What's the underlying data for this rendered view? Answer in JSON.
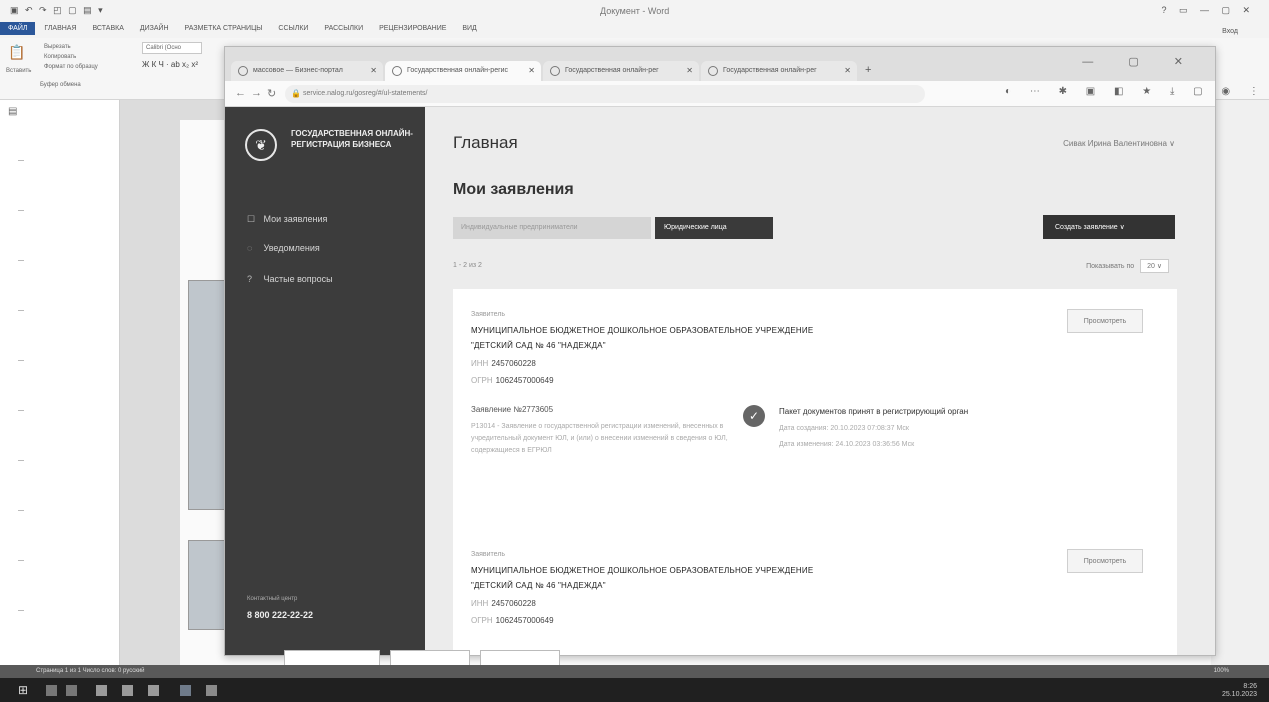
{
  "word": {
    "title": "Документ - Word",
    "tabs": [
      "ФАЙЛ",
      "ГЛАВНАЯ",
      "ВСТАВКА",
      "ДИЗАЙН",
      "РАЗМЕТКА СТРАНИЦЫ",
      "ССЫЛКИ",
      "РАССЫЛКИ",
      "РЕЦЕНЗИРОВАНИЕ",
      "ВИД"
    ],
    "user": "Вход",
    "font_box": "Calibri (Осно",
    "clipboard_label": "Буфер обмена",
    "paste_label": "Вставить",
    "cut_label": "Вырезать",
    "copy_label": "Копировать",
    "format_label": "Формат по образцу"
  },
  "browser": {
    "tabs": [
      {
        "title": "массовое — Бизнес-портал"
      },
      {
        "title": "Государственная онлайн-регис"
      },
      {
        "title": "Государственная онлайн-рег"
      },
      {
        "title": "Государственная онлайн-рег"
      }
    ],
    "url": "service.nalog.ru/gosreg/#/ul-statements/"
  },
  "sidebar": {
    "brand": "ГОСУДАРСТВЕННАЯ ОНЛАЙН-РЕГИСТРАЦИЯ БИЗНЕСА",
    "menu": [
      {
        "icon": "☐",
        "label": "Мои заявления"
      },
      {
        "icon": "◌",
        "label": "Уведомления"
      },
      {
        "icon": "?",
        "label": "Частые вопросы"
      }
    ],
    "hotline_label": "Контактный центр",
    "hotline": "8 800 222-22-22"
  },
  "header": {
    "title": "Главная",
    "user": "Сивак Ирина Валентиновна"
  },
  "statements": {
    "title": "Мои заявления",
    "tab_ip": "Индивидуальные предприниматели",
    "tab_ul": "Юридические лица",
    "create_button": "Создать заявление ∨",
    "pager": "1 - 2 из 2",
    "per_page_label": "Показывать по",
    "per_page_value": "20"
  },
  "cards": [
    {
      "label": "Заявитель",
      "name_line1": "МУНИЦИПАЛЬНОЕ БЮДЖЕТНОЕ ДОШКОЛЬНОЕ ОБРАЗОВАТЕЛЬНОЕ УЧРЕЖДЕНИЕ",
      "name_line2": "\"ДЕТСКИЙ САД № 46 \"НАДЕЖДА\"",
      "inn_key": "ИНН",
      "inn": "2457060228",
      "ogrn_key": "ОГРН",
      "ogrn": "1062457000649",
      "button": "Просмотреть",
      "app": "Заявление №2773605",
      "desc": "Р13014 - Заявление о государственной регистрации изменений, внесенных в учредительный документ ЮЛ, и (или) о внесении изменений в сведения о ЮЛ, содержащиеся в ЕГРЮЛ",
      "status": "Пакет документов принят в регистрирующий орган",
      "created": "Дата создания: 20.10.2023 07:08:37 Мск",
      "changed": "Дата изменения: 24.10.2023 03:36:56 Мск"
    },
    {
      "label": "Заявитель",
      "name_line1": "МУНИЦИПАЛЬНОЕ БЮДЖЕТНОЕ ДОШКОЛЬНОЕ ОБРАЗОВАТЕЛЬНОЕ УЧРЕЖДЕНИЕ",
      "name_line2": "\"ДЕТСКИЙ САД № 46 \"НАДЕЖДА\"",
      "inn_key": "ИНН",
      "inn": "2457060228",
      "ogrn_key": "ОГРН",
      "ogrn": "1062457000649",
      "button": "Просмотреть"
    }
  ],
  "statusbar": {
    "left": "Страница 1 из 1   Число слов: 0   русский",
    "right": "100%"
  },
  "taskbar": {
    "time": "8:26",
    "date": "25.10.2023"
  }
}
